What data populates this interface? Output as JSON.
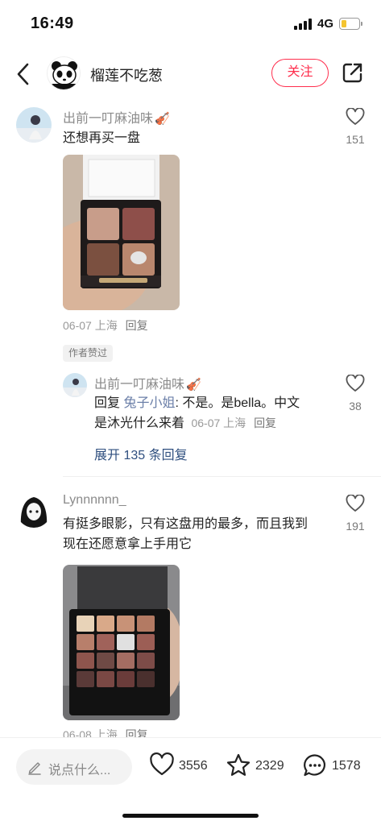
{
  "status_bar": {
    "time": "16:49",
    "network": "4G",
    "battery_level": 0.3,
    "icons": [
      "signal-icon",
      "battery-icon"
    ]
  },
  "header": {
    "author_name": "榴莲不吃葱",
    "follow_label": "关注",
    "icons": [
      "back-arrow-icon",
      "panda-avatar",
      "share-icon"
    ],
    "accent_color": "#ff2e4d"
  },
  "comments": [
    {
      "username": "出前一叮麻油味",
      "text": "还想再买一盘",
      "likes": "151",
      "date": "06-07",
      "location": "上海",
      "reply_label": "回复",
      "author_liked_label": "作者赞过",
      "replies": [
        {
          "username": "出前一叮麻油味",
          "reply_prefix": "回复",
          "mention": "兔子小姐",
          "text_line1": ": 不是。是bella。中文",
          "text_line2": "是沐光什么来着",
          "likes": "38",
          "date": "06-07",
          "location": "上海",
          "reply_label": "回复"
        }
      ],
      "expand_label": "展开 135 条回复"
    },
    {
      "username": "Lynnnnnn_",
      "text_line1": "有挺多眼影，只有这盘用的最多，而且我到",
      "text_line2": "现在还愿意拿上手用它",
      "likes": "191",
      "date": "06-08",
      "location": "上海",
      "reply_label": "回复"
    }
  ],
  "bottom_bar": {
    "input_placeholder": "说点什么...",
    "likes": "3556",
    "favorites": "2329",
    "comments": "1578",
    "icons": [
      "pen-icon",
      "heart-icon",
      "star-icon",
      "comment-icon"
    ]
  }
}
